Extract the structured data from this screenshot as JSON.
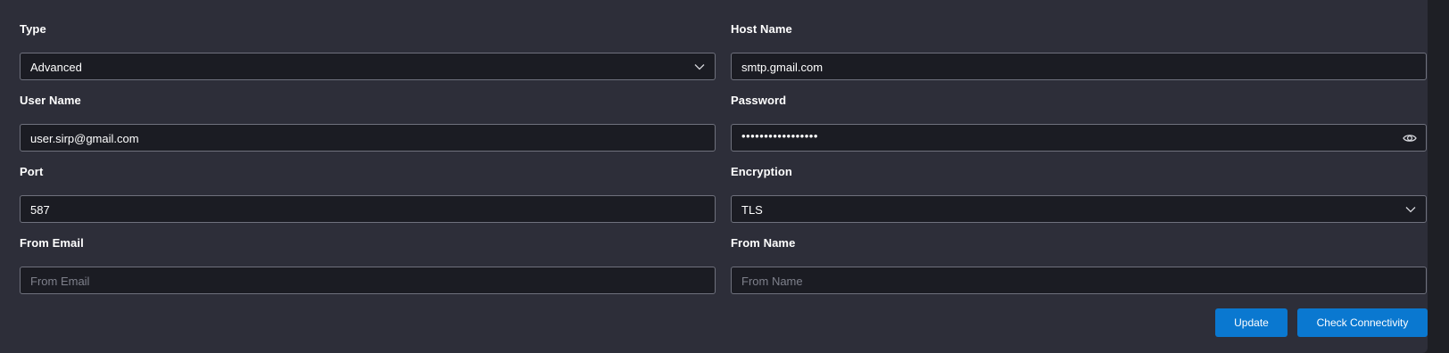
{
  "form": {
    "type": {
      "label": "Type",
      "value": "Advanced"
    },
    "host_name": {
      "label": "Host Name",
      "value": "smtp.gmail.com"
    },
    "user_name": {
      "label": "User Name",
      "value": "user.sirp@gmail.com"
    },
    "password": {
      "label": "Password",
      "value": "•••••••••••••••••"
    },
    "port": {
      "label": "Port",
      "value": "587"
    },
    "encryption": {
      "label": "Encryption",
      "value": "TLS"
    },
    "from_email": {
      "label": "From Email",
      "placeholder": "From Email"
    },
    "from_name": {
      "label": "From Name",
      "placeholder": "From Name"
    }
  },
  "actions": {
    "update_label": "Update",
    "check_label": "Check Connectivity"
  },
  "icons": {
    "type_chevron": "chevron-down-icon",
    "encryption_chevron": "chevron-down-icon",
    "password_toggle": "eye-icon"
  },
  "colors": {
    "panel": "#2d2e39",
    "field_bg": "#1b1c23",
    "field_border": "#6f717d",
    "button": "#0a78d0"
  }
}
